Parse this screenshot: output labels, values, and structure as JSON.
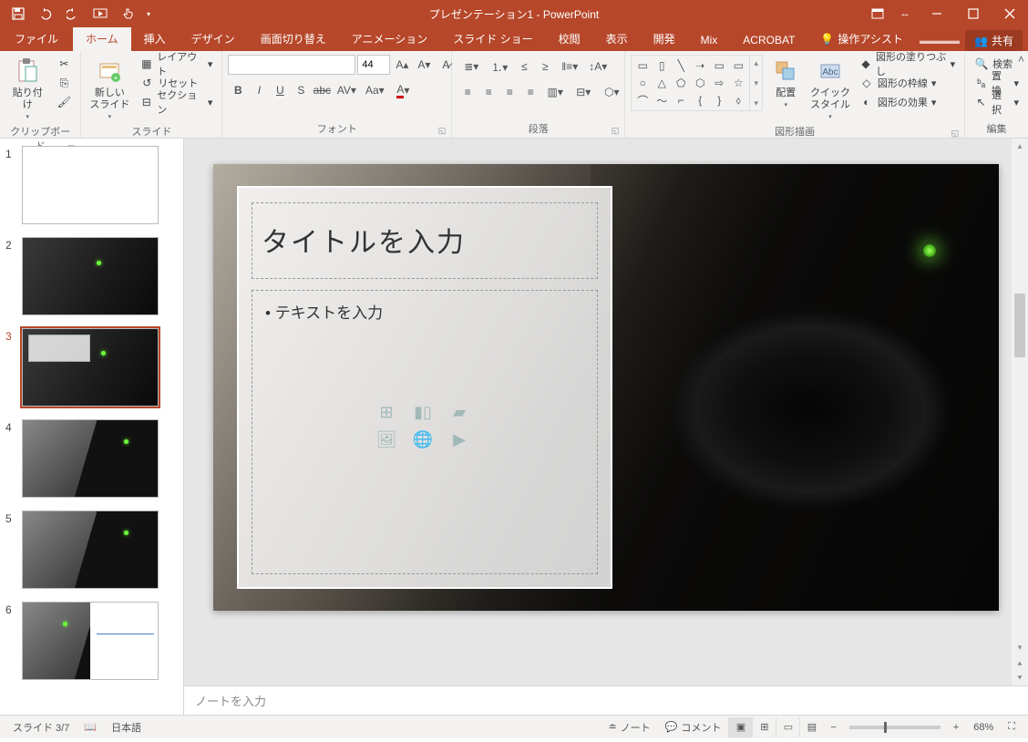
{
  "app": {
    "title": "プレゼンテーション1 - PowerPoint"
  },
  "qat": {
    "save": "保存",
    "undo": "元に戻す",
    "redo": "やり直し",
    "start": "最初から",
    "touch": "タッチ/マウス"
  },
  "tabs": {
    "file": "ファイル",
    "home": "ホーム",
    "insert": "挿入",
    "design": "デザイン",
    "transitions": "画面切り替え",
    "animations": "アニメーション",
    "slideshow": "スライド ショー",
    "review": "校閲",
    "view": "表示",
    "developer": "開発",
    "mix": "Mix",
    "acrobat": "ACROBAT",
    "tellme": "操作アシスト"
  },
  "share": "共有",
  "ribbon": {
    "clipboard": {
      "label": "クリップボード",
      "paste": "貼り付け",
      "cut": "切り取り",
      "copy": "コピー",
      "format_painter": "書式のコピー"
    },
    "slides": {
      "label": "スライド",
      "new_slide": "新しい\nスライド",
      "layout": "レイアウト",
      "reset": "リセット",
      "section": "セクション"
    },
    "font": {
      "label": "フォント",
      "size": "44"
    },
    "paragraph": {
      "label": "段落"
    },
    "drawing": {
      "label": "図形描画",
      "arrange": "配置",
      "quick_styles": "クイック\nスタイル",
      "shape_fill": "図形の塗りつぶし",
      "shape_outline": "図形の枠線",
      "shape_effects": "図形の効果"
    },
    "editing": {
      "label": "編集",
      "find": "検索",
      "replace": "置換",
      "select": "選択"
    }
  },
  "slide_content": {
    "title_placeholder": "タイトルを入力",
    "body_placeholder": "テキストを入力"
  },
  "notes_placeholder": "ノートを入力",
  "status": {
    "slide_indicator": "スライド 3/7",
    "language": "日本語",
    "notes_btn": "ノート",
    "comments_btn": "コメント",
    "zoom": "68%"
  },
  "thumbnails": [
    {
      "n": "1"
    },
    {
      "n": "2"
    },
    {
      "n": "3"
    },
    {
      "n": "4"
    },
    {
      "n": "5"
    },
    {
      "n": "6"
    }
  ]
}
